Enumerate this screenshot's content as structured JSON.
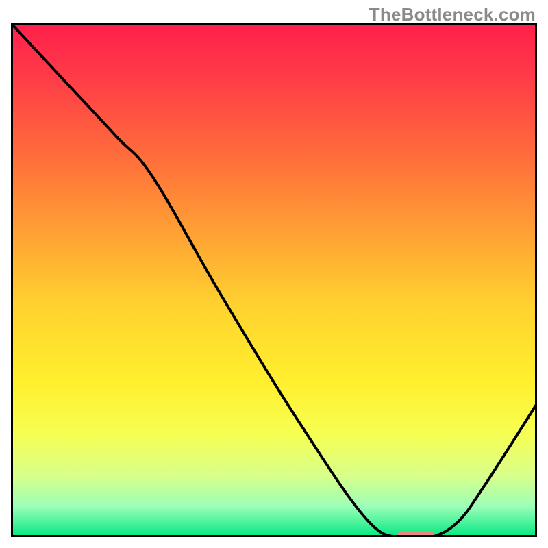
{
  "watermark": "TheBottleneck.com",
  "chart_data": {
    "type": "line",
    "title": "",
    "xlabel": "",
    "ylabel": "",
    "xlim": [
      0,
      100
    ],
    "ylim": [
      0,
      100
    ],
    "grid": false,
    "legend": false,
    "series": [
      {
        "name": "curve",
        "x": [
          0,
          10,
          20,
          27,
          40,
          55,
          68,
          75,
          80,
          85,
          90,
          100
        ],
        "values": [
          100,
          89,
          78,
          70,
          47,
          22,
          3,
          0,
          0,
          3,
          10,
          26
        ]
      }
    ],
    "marker": {
      "x_center": 77,
      "x_half_width": 3.5,
      "y": 0.4,
      "color": "#e8897d"
    },
    "background_gradient_stops": [
      {
        "offset": 0.0,
        "color": "#ff1f4b"
      },
      {
        "offset": 0.1,
        "color": "#ff3a48"
      },
      {
        "offset": 0.25,
        "color": "#ff6a3c"
      },
      {
        "offset": 0.4,
        "color": "#ff9e34"
      },
      {
        "offset": 0.55,
        "color": "#ffd22f"
      },
      {
        "offset": 0.7,
        "color": "#fff02e"
      },
      {
        "offset": 0.8,
        "color": "#f6ff52"
      },
      {
        "offset": 0.88,
        "color": "#d8ff8a"
      },
      {
        "offset": 0.94,
        "color": "#9dffb8"
      },
      {
        "offset": 1.0,
        "color": "#00e882"
      }
    ],
    "frame_stroke": "#000000",
    "frame_stroke_width": 6,
    "curve_stroke": "#000000",
    "curve_stroke_width": 4
  }
}
